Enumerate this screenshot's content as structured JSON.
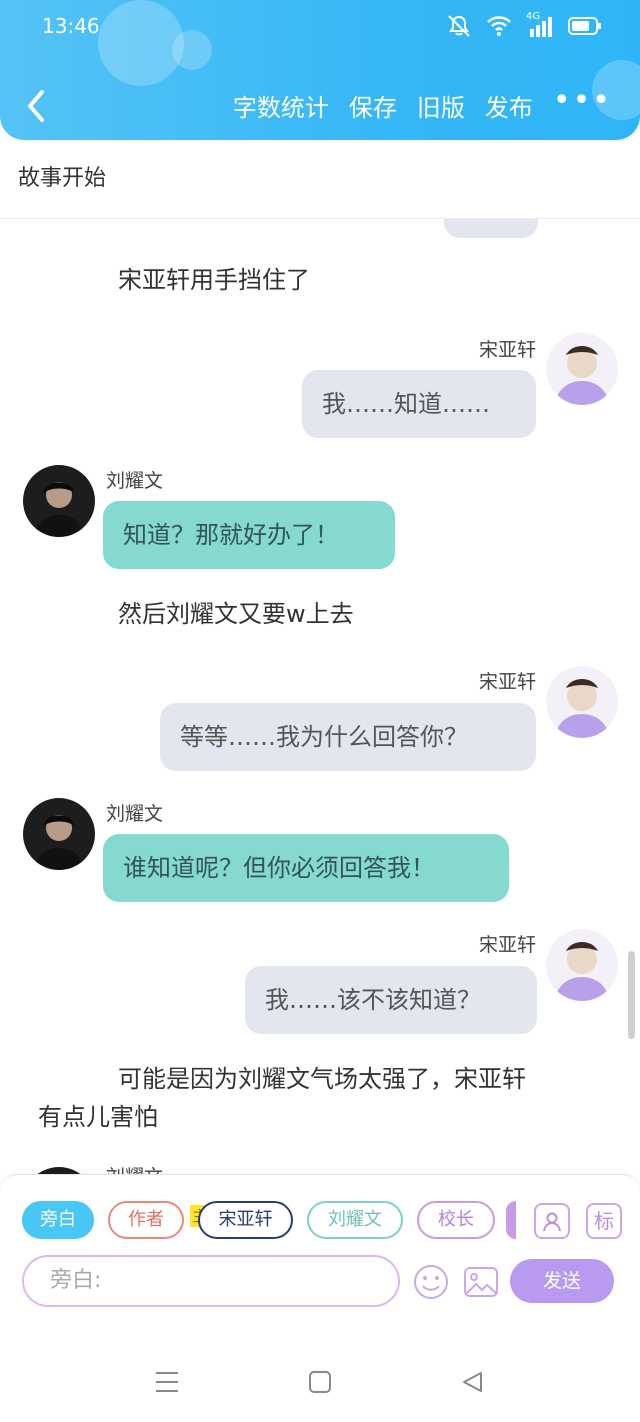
{
  "status": {
    "time": "13:46",
    "signal_label": "4G"
  },
  "toolbar": {
    "word_count": "字数统计",
    "save": "保存",
    "old_version": "旧版",
    "publish": "发布",
    "more": "•••"
  },
  "story_title": "故事开始",
  "messages": [
    {
      "type": "narration",
      "text": "宋亚轩用手挡住了"
    },
    {
      "type": "right",
      "speaker": "宋亚轩",
      "text": "我……知道……"
    },
    {
      "type": "left",
      "speaker": "刘耀文",
      "text": "知道？那就好办了！"
    },
    {
      "type": "narration",
      "text": "然后刘耀文又要w上去"
    },
    {
      "type": "right",
      "speaker": "宋亚轩",
      "text": "等等……我为什么回答你？"
    },
    {
      "type": "left",
      "speaker": "刘耀文",
      "text": "谁知道呢？但你必须回答我！"
    },
    {
      "type": "right",
      "speaker": "宋亚轩",
      "text": "我……该不该知道？"
    },
    {
      "type": "narration",
      "text_line1": "可能是因为刘耀文气场太强了，宋亚轩",
      "text_line2": "有点儿害怕"
    },
    {
      "type": "left",
      "speaker": "刘耀文"
    }
  ],
  "roles": {
    "narrator": "旁白",
    "author": "作者",
    "main_tag": "主",
    "song": "宋亚轩",
    "liu": "刘耀文",
    "principal": "校长"
  },
  "tools": {
    "profile_icon": "person-card-icon",
    "mark": "标"
  },
  "composer": {
    "placeholder": "旁白:",
    "send": "发送"
  },
  "colors": {
    "header": "#36b7f6",
    "teal_bubble": "#86d9cf",
    "gray_bubble": "#e3e6ee",
    "send": "#b89af0"
  }
}
